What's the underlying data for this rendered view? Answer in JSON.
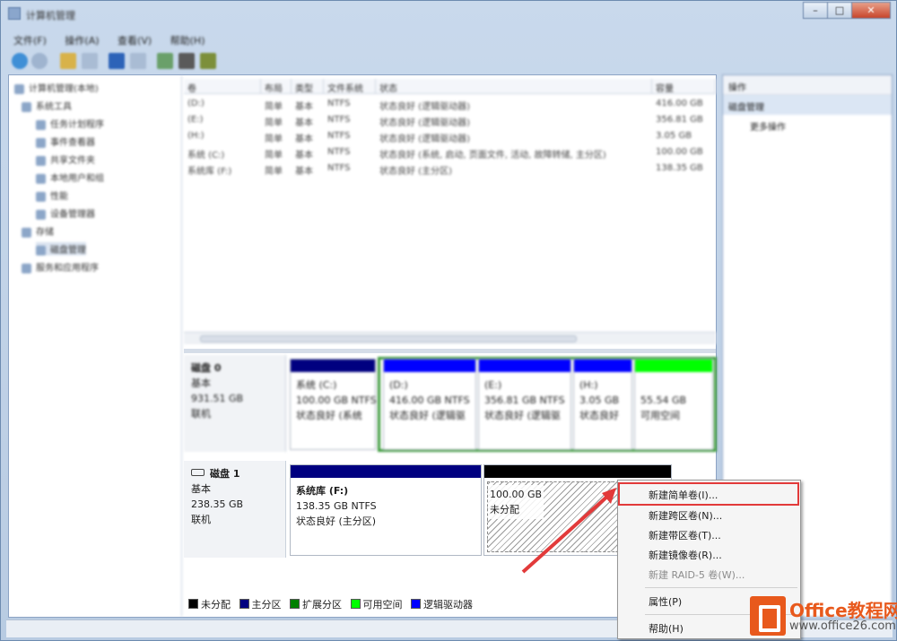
{
  "window": {
    "title": "计算机管理"
  },
  "menu": [
    "文件(F)",
    "操作(A)",
    "查看(V)",
    "帮助(H)"
  ],
  "tree": [
    "计算机管理(本地)",
    "系统工具",
    "任务计划程序",
    "事件查看器",
    "共享文件夹",
    "本地用户和组",
    "性能",
    "设备管理器",
    "存储",
    "磁盘管理",
    "服务和应用程序"
  ],
  "volume_table": {
    "headers": [
      "卷",
      "布局",
      "类型",
      "文件系统",
      "状态",
      "容量"
    ],
    "rows": [
      [
        "(D:)",
        "简单",
        "基本",
        "NTFS",
        "状态良好 (逻辑驱动器)",
        "416.00 GB"
      ],
      [
        "(E:)",
        "简单",
        "基本",
        "NTFS",
        "状态良好 (逻辑驱动器)",
        "356.81 GB"
      ],
      [
        "(H:)",
        "简单",
        "基本",
        "NTFS",
        "状态良好 (逻辑驱动器)",
        "3.05 GB"
      ],
      [
        "系统 (C:)",
        "简单",
        "基本",
        "NTFS",
        "状态良好 (系统, 启动, 页面文件, 活动, 故障转储, 主分区)",
        "100.00 GB"
      ],
      [
        "系统库 (F:)",
        "简单",
        "基本",
        "NTFS",
        "状态良好 (主分区)",
        "138.35 GB"
      ]
    ]
  },
  "disk0": {
    "name": "磁盘 0",
    "type": "基本",
    "size": "931.51 GB",
    "status": "联机",
    "partitions": [
      {
        "name": "系统 (C:)",
        "detail": "100.00 GB NTFS",
        "status": "状态良好 (系统"
      },
      {
        "name": "(D:)",
        "detail": "416.00 GB NTFS",
        "status": "状态良好 (逻辑驱"
      },
      {
        "name": "(E:)",
        "detail": "356.81 GB NTFS",
        "status": "状态良好 (逻辑驱"
      },
      {
        "name": "(H:)",
        "detail": "3.05 GB",
        "status": "状态良好"
      },
      {
        "name": "",
        "detail": "55.54 GB",
        "status": "可用空间"
      }
    ]
  },
  "disk1": {
    "name": "磁盘 1",
    "type": "基本",
    "size": "238.35 GB",
    "status": "联机",
    "partitions": [
      {
        "name": "系统库  (F:)",
        "detail": "138.35 GB NTFS",
        "status": "状态良好 (主分区)"
      },
      {
        "detail": "100.00 GB",
        "status": "未分配"
      }
    ]
  },
  "legend": [
    {
      "label": "未分配",
      "color": "#000000"
    },
    {
      "label": "主分区",
      "color": "#000080"
    },
    {
      "label": "扩展分区",
      "color": "#008000"
    },
    {
      "label": "可用空间",
      "color": "#00ff00"
    },
    {
      "label": "逻辑驱动器",
      "color": "#0000ff"
    }
  ],
  "actions": {
    "header": "操作",
    "section": "磁盘管理",
    "more": "更多操作"
  },
  "context_menu": {
    "new_simple": "新建简单卷(I)...",
    "new_spanned": "新建跨区卷(N)...",
    "new_striped": "新建带区卷(T)...",
    "new_mirrored": "新建镜像卷(R)...",
    "new_raid5": "新建 RAID-5 卷(W)...",
    "properties": "属性(P)",
    "help": "帮助(H)"
  },
  "watermark": {
    "brand": "Office教程网",
    "url": "www.office26.com"
  }
}
